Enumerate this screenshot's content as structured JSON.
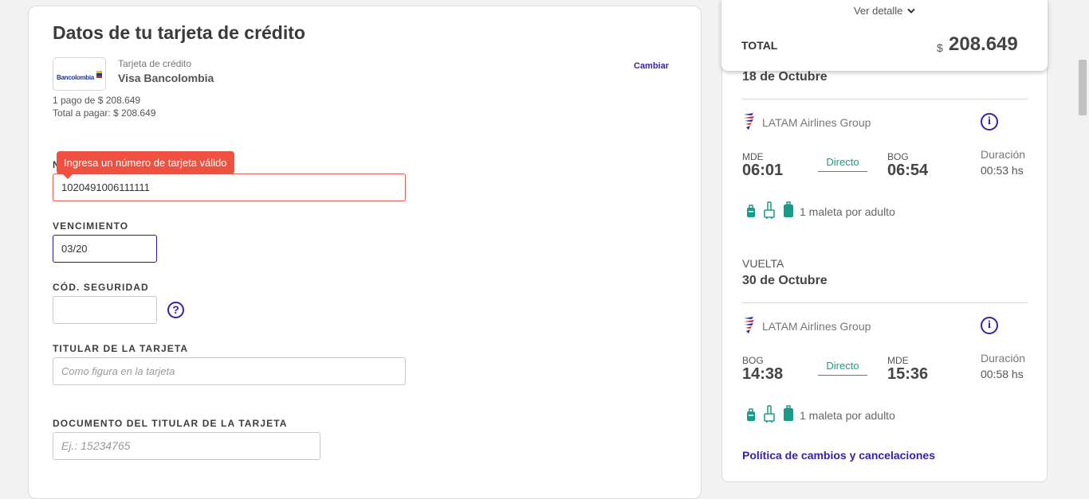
{
  "payment": {
    "title": "Datos de tu tarjeta de crédito",
    "bank_logo_text": "Bancolombia",
    "card_type": "Tarjeta de crédito",
    "card_name": "Visa Bancolombia",
    "change_label": "Cambiar",
    "installments": "1 pago de $ 208.649",
    "total_to_pay": "Total a pagar: $ 208.649",
    "card_number_error": "Ingresa un número de tarjeta válido",
    "card_number_value": "1020491006111111",
    "expiry_label": "VENCIMIENTO",
    "expiry_value": "03/20",
    "cvv_label": "CÓD. SEGURIDAD",
    "cvv_value": "",
    "holder_label": "TITULAR DE LA TARJETA",
    "holder_placeholder": "Como figura en la tarjeta",
    "document_label": "DOCUMENTO DEL TITULAR DE LA TARJETA",
    "document_placeholder": "Ej.: 15234765"
  },
  "summary": {
    "detail_toggle": "Ver detalle",
    "total_label": "TOTAL",
    "total_currency": "$",
    "total_value": "208.649",
    "outbound": {
      "date": "18 de Octubre",
      "airline": "LATAM Airlines Group",
      "from_code": "MDE",
      "from_time": "06:01",
      "stops": "Directo",
      "to_code": "BOG",
      "to_time": "06:54",
      "duration_label": "Duración",
      "duration": "00:53 hs",
      "baggage": "1 maleta por adulto"
    },
    "return": {
      "label": "VUELTA",
      "date": "30 de Octubre",
      "airline": "LATAM Airlines Group",
      "from_code": "BOG",
      "from_time": "14:38",
      "stops": "Directo",
      "to_code": "MDE",
      "to_time": "15:36",
      "duration_label": "Duración",
      "duration": "00:58 hs",
      "baggage": "1 maleta por adulto"
    },
    "policy_link": "Política de cambios y cancelaciones"
  },
  "colors": {
    "accent": "#3b1ea8",
    "error": "#f0503f",
    "teal": "#1a9a8a"
  }
}
